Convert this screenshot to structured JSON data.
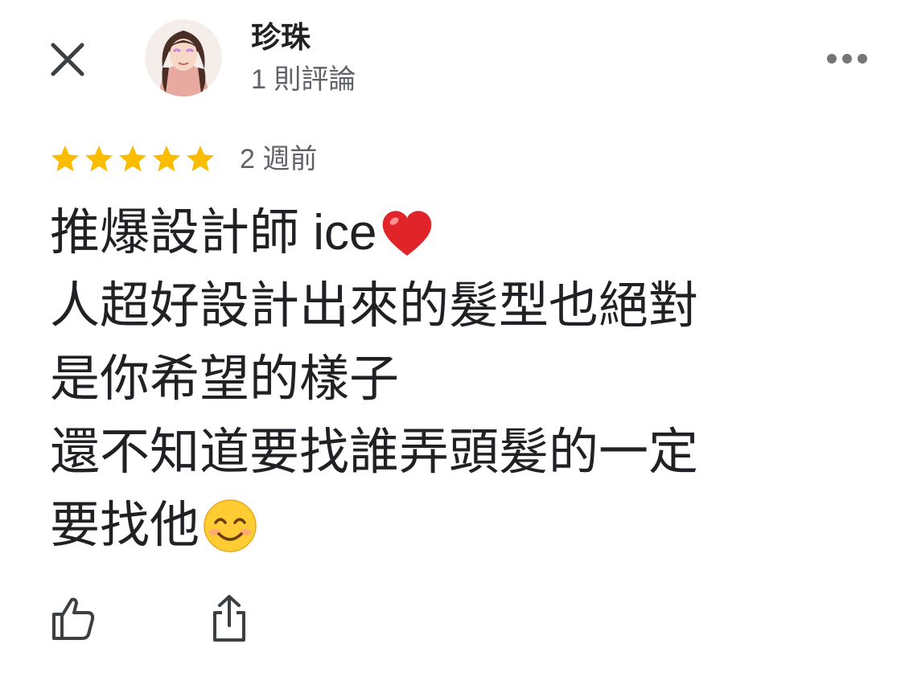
{
  "header": {
    "author_name": "珍珠",
    "author_meta": "1 則評論",
    "close_icon": "close-icon",
    "more_icon": "more-horizontal-icon"
  },
  "review": {
    "rating": 5,
    "rating_max": 5,
    "time": "2 週前",
    "star_color": "#fbbc04",
    "lines": [
      {
        "text": "推爆設計師 ice",
        "emoji": "heart-emoji"
      },
      {
        "text": "人超好設計出來的髮型也絕對",
        "emoji": ""
      },
      {
        "text": "是你希望的樣子",
        "emoji": ""
      },
      {
        "text": "還不知道要找誰弄頭髮的一定",
        "emoji": ""
      },
      {
        "text": "要找他",
        "emoji": "smiling-face-emoji"
      }
    ]
  },
  "actions": {
    "like_icon": "thumbs-up-icon",
    "share_icon": "share-icon"
  }
}
